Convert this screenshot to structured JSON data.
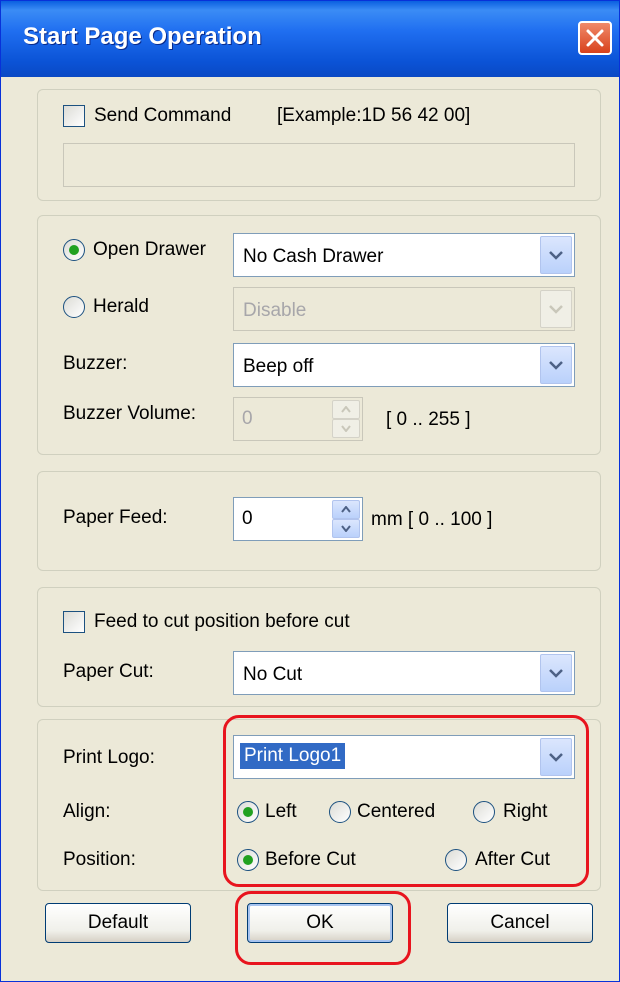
{
  "window": {
    "title": "Start Page Operation"
  },
  "send_command": {
    "checkbox_label": "Send Command",
    "example": "[Example:1D 56 42 00]",
    "value": ""
  },
  "drawer": {
    "open_drawer_label": "Open Drawer",
    "open_drawer_value": "No Cash Drawer",
    "herald_label": "Herald",
    "herald_value": "Disable",
    "buzzer_label": "Buzzer:",
    "buzzer_value": "Beep off",
    "volume_label": "Buzzer Volume:",
    "volume_value": "0",
    "volume_range": "[ 0 .. 255 ]"
  },
  "paper_feed": {
    "label": "Paper Feed:",
    "value": "0",
    "range": "mm [ 0 .. 100 ]"
  },
  "paper_cut": {
    "feed_checkbox_label": "Feed to cut position before cut",
    "label": "Paper Cut:",
    "value": "No Cut"
  },
  "logo": {
    "print_logo_label": "Print Logo:",
    "print_logo_value": "Print Logo1",
    "align_label": "Align:",
    "align_left": "Left",
    "align_centered": "Centered",
    "align_right": "Right",
    "position_label": "Position:",
    "position_before": "Before Cut",
    "position_after": "After Cut"
  },
  "buttons": {
    "default": "Default",
    "ok": "OK",
    "cancel": "Cancel"
  },
  "colors": {
    "highlight": "#e8141e",
    "title_bar": "#0b53d6",
    "dialog_bg": "#ece9d8"
  }
}
